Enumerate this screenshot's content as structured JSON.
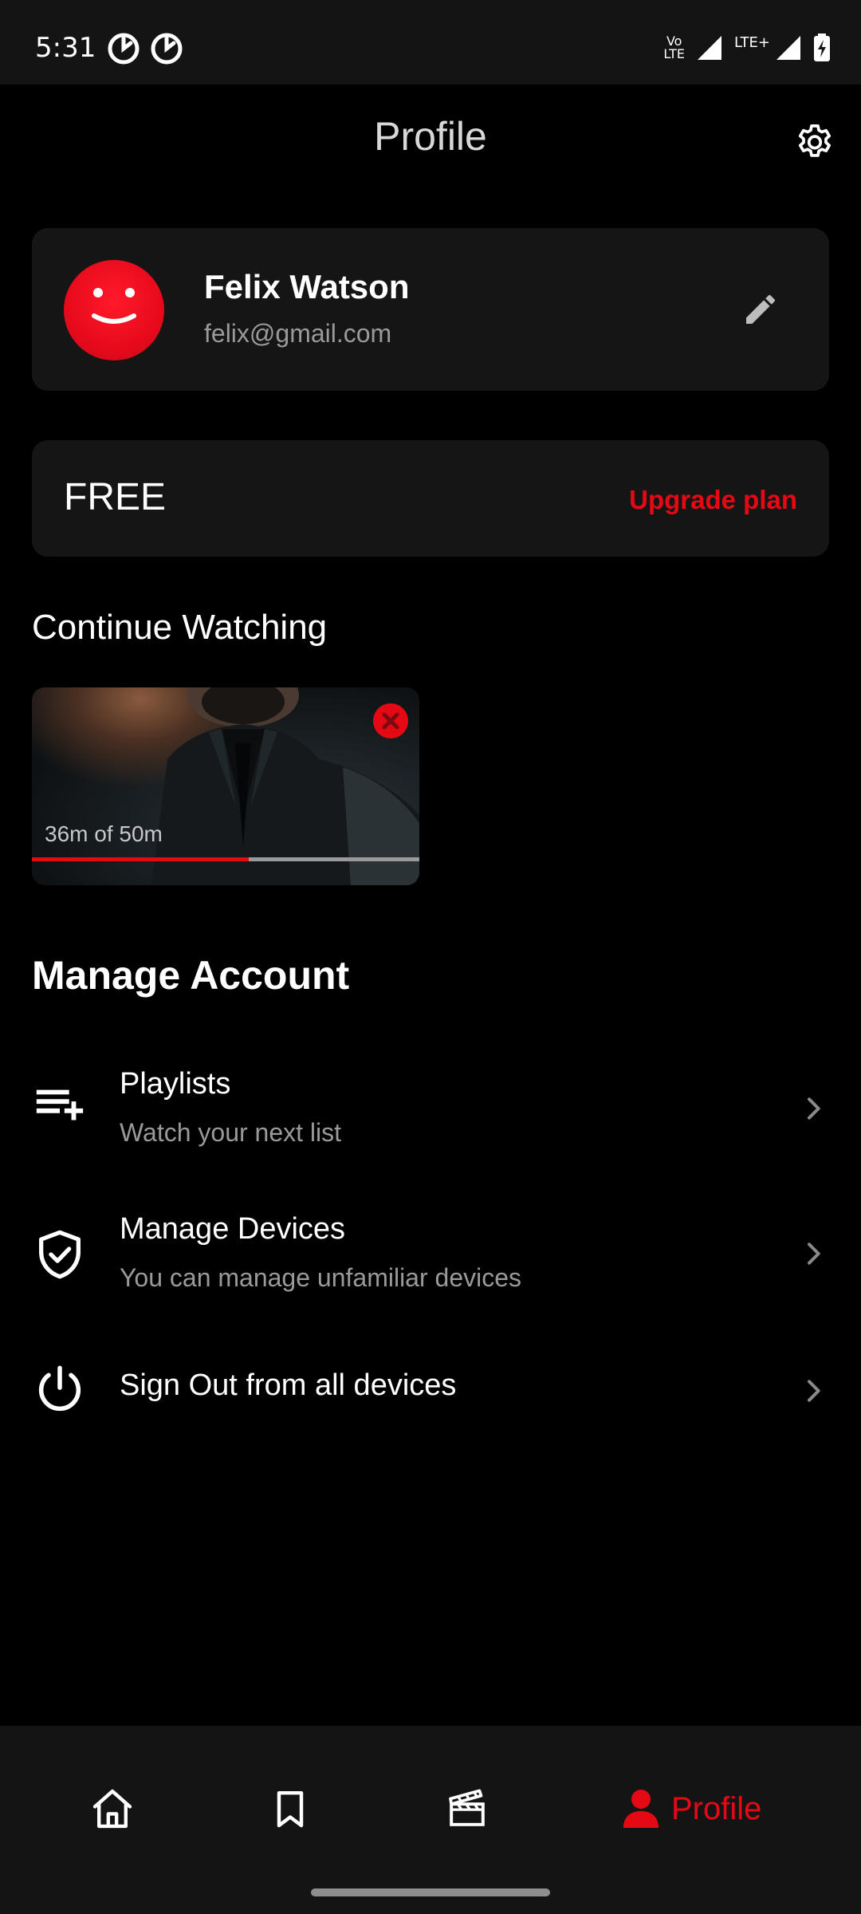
{
  "status_bar": {
    "time": "5:31",
    "volte_line1": "Vo",
    "volte_line2": "LTE",
    "lte_plus": "LTE+",
    "icons": [
      "app-notification-icon",
      "app-notification-icon",
      "volte-icon",
      "signal-icon",
      "lte-signal-icon",
      "battery-charging-icon"
    ]
  },
  "header": {
    "title": "Profile",
    "settings_icon": "gear-icon"
  },
  "profile": {
    "name": "Felix Watson",
    "email": "felix@gmail.com",
    "avatar_icon": "smiley-avatar",
    "edit_icon": "pencil-icon"
  },
  "plan": {
    "label": "FREE",
    "upgrade_label": "Upgrade plan"
  },
  "continue_watching": {
    "title": "Continue Watching",
    "items": [
      {
        "progress_text": "36m of 50m",
        "progress": 0.56,
        "remove_icon": "close-icon"
      }
    ]
  },
  "manage_account": {
    "title": "Manage Account",
    "items": [
      {
        "icon": "playlist-add-icon",
        "title": "Playlists",
        "subtitle": "Watch your next list"
      },
      {
        "icon": "shield-check-icon",
        "title": "Manage Devices",
        "subtitle": "You can manage unfamiliar devices"
      },
      {
        "icon": "power-icon",
        "title": "Sign Out from all devices",
        "subtitle": ""
      }
    ]
  },
  "bottom_nav": {
    "items": [
      {
        "icon": "home-icon",
        "label": ""
      },
      {
        "icon": "bookmark-icon",
        "label": ""
      },
      {
        "icon": "clapperboard-icon",
        "label": ""
      },
      {
        "icon": "person-icon",
        "label": "Profile",
        "active": true
      }
    ]
  },
  "colors": {
    "accent": "#e50914",
    "background": "#000000",
    "card": "#151515",
    "muted_text": "#9a9a9a"
  }
}
